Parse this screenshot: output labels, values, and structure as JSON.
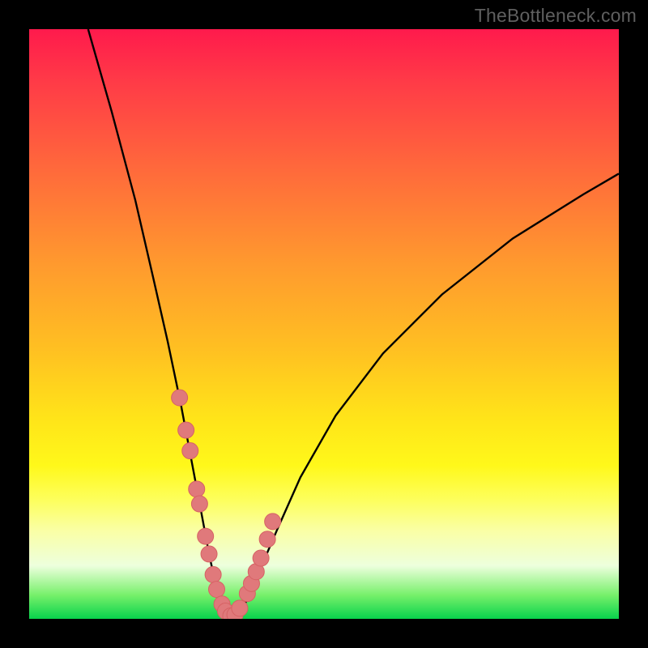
{
  "watermark": "TheBottleneck.com",
  "colors": {
    "background": "#000000",
    "curve": "#000000",
    "marker_fill": "#e0797b",
    "marker_stroke": "#d66264",
    "gradient_top": "#ff1a4c",
    "gradient_bottom": "#08d34c"
  },
  "chart_data": {
    "type": "line",
    "title": "",
    "xlabel": "",
    "ylabel": "",
    "xlim": [
      0,
      100
    ],
    "ylim": [
      0,
      100
    ],
    "grid": false,
    "legend": false,
    "series": [
      {
        "name": "bottleneck-curve",
        "x": [
          10,
          14,
          18,
          21,
          23.5,
          25.8,
          27.5,
          29.2,
          30.6,
          31.8,
          32.8,
          33.5,
          34,
          34.4,
          35.5,
          36.5,
          39,
          42,
          46,
          52,
          60,
          70,
          82,
          94,
          100
        ],
        "y": [
          100,
          86,
          71,
          58,
          47,
          36,
          27,
          18,
          10.5,
          5.2,
          2.2,
          0.8,
          0.2,
          0.2,
          0.9,
          2.3,
          8,
          15,
          24,
          34.5,
          45,
          55,
          64.5,
          72,
          75.5
        ]
      }
    ],
    "markers": {
      "name": "salmon-dots",
      "x": [
        25.5,
        26.6,
        27.3,
        28.4,
        28.9,
        29.9,
        30.5,
        31.2,
        31.8,
        32.7,
        33.3,
        34.2,
        34.9,
        35.7,
        37.0,
        37.7,
        38.5,
        39.3,
        40.4,
        41.3
      ],
      "y": [
        37.5,
        32.0,
        28.5,
        22.0,
        19.5,
        14.0,
        11.0,
        7.5,
        5.0,
        2.5,
        1.3,
        0.5,
        0.7,
        1.8,
        4.3,
        6.0,
        8.0,
        10.3,
        13.5,
        16.5
      ]
    }
  }
}
